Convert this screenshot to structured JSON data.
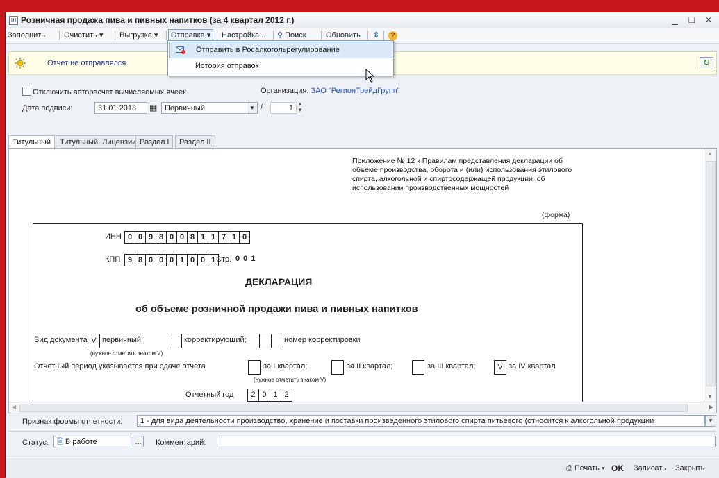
{
  "window": {
    "title": "Розничная продажа пива и пивных напитков (за 4 квартал 2012 г.)",
    "controls": "_ □ ×"
  },
  "toolbar": {
    "fill": "Заполнить",
    "clear": "Очистить ▾",
    "export": "Выгрузка ▾",
    "send": "Отправка ▾",
    "settings": "Настройка...",
    "search": "Поиск",
    "refresh": "Обновить",
    "help": "?"
  },
  "send_menu": {
    "items": [
      {
        "label": "Отправить в Росалкогольрегулирование"
      },
      {
        "label": "История отправок"
      }
    ]
  },
  "info": {
    "status_text": "Отчет не отправлялся."
  },
  "options": {
    "autocalc_label": "Отключить авторасчет вычисляемых ячеек",
    "org_label": "Организация:",
    "org_value": "ЗАО \"РегионТрейдГрупп\""
  },
  "sign": {
    "date_label": "Дата подписи:",
    "date_value": "31.01.2013",
    "kind_value": "Первичный",
    "slash": "/",
    "number_value": "1"
  },
  "tabs": [
    {
      "label": "Титульный"
    },
    {
      "label": "Титульный. Лицензии"
    },
    {
      "label": "Раздел I"
    },
    {
      "label": "Раздел II"
    }
  ],
  "document": {
    "appendix": "Приложение № 12 к Правилам представления декларации об объеме производства, оборота и (или) использования этилового спирта, алкогольной и спиртосодержащей продукции, об использовании производственных мощностей",
    "forma": "(форма)",
    "inn_label": "ИНН",
    "inn": [
      "0",
      "0",
      "9",
      "8",
      "0",
      "0",
      "8",
      "1",
      "1",
      "7",
      "1",
      "0"
    ],
    "kpp_label": "КПП",
    "kpp": [
      "9",
      "8",
      "0",
      "0",
      "0",
      "1",
      "0",
      "0",
      "1"
    ],
    "page_label": "Стр.",
    "page": "0 0 1",
    "title": "ДЕКЛАРАЦИЯ",
    "subtitle": "об объеме розничной продажи пива и пивных напитков",
    "doc_type_label": "Вид документа",
    "primary_mark": "V",
    "primary_label": "первичный;",
    "corrective_label": "корректирующий;",
    "correction_number_label": "номер корректировки",
    "mark_note": "(нужное отметить знаком V)",
    "period_label": "Отчетный период указывается при сдаче отчета",
    "q1": "за I квартал;",
    "q2": "за II квартал;",
    "q3": "за III квартал;",
    "q4_mark": "V",
    "q4": "за IV квартал",
    "year_label": "Отчетный год",
    "year": [
      "2",
      "0",
      "1",
      "2"
    ]
  },
  "form_sign": {
    "label": "Признак формы отчетности:",
    "value": "1 - для вида деятельности производство, хранение и поставки произведенного этилового спирта питьевого (относится к алкогольной продукции"
  },
  "status": {
    "label": "Статус:",
    "value": "В работе",
    "more": "...",
    "comment_label": "Комментарий:"
  },
  "footer": {
    "print": "Печать ▾",
    "ok": "OK",
    "save": "Записать",
    "close": "Закрыть"
  },
  "colors": {
    "frame": "#c8171b",
    "link": "#2a57b0",
    "info_bg": "#fffee6"
  }
}
